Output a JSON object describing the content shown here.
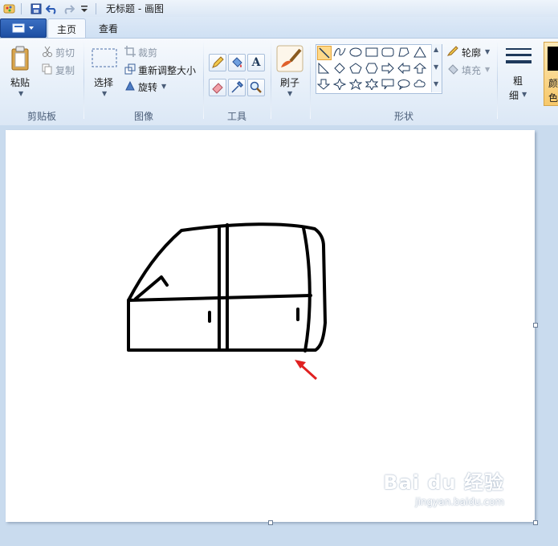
{
  "titlebar": {
    "title": "无标题 - 画图",
    "icons": [
      "paint-app-icon",
      "save-icon",
      "undo-icon",
      "redo-icon",
      "customize-quick-access-icon"
    ]
  },
  "tabs": {
    "home": "主页",
    "view": "查看"
  },
  "clipboard": {
    "paste": "粘贴",
    "cut": "剪切",
    "copy": "复制",
    "group": "剪贴板"
  },
  "image": {
    "select": "选择",
    "crop": "裁剪",
    "resize": "重新调整大小",
    "rotate": "旋转",
    "group": "图像"
  },
  "tools": {
    "group": "工具",
    "items": [
      "pencil-icon",
      "fill-bucket-icon",
      "text-icon",
      "eraser-icon",
      "color-picker-icon",
      "magnifier-icon"
    ],
    "text_glyph": "A"
  },
  "brushes": {
    "label": "刷子"
  },
  "shapes": {
    "group": "形状",
    "outline": "轮廓",
    "fill": "填充",
    "selected": "line"
  },
  "size": {
    "label_line1": "粗",
    "label_line2": "细"
  },
  "color1": {
    "label_partial": "颜",
    "label_partial2": "色"
  },
  "watermark": {
    "brand": "Bai du 经验",
    "url": "jingyan.baidu.com"
  },
  "colors": {
    "accent": "#1d4fa3",
    "selection": "#ffd98a",
    "arrow": "#e02020",
    "stroke": "#000000"
  }
}
